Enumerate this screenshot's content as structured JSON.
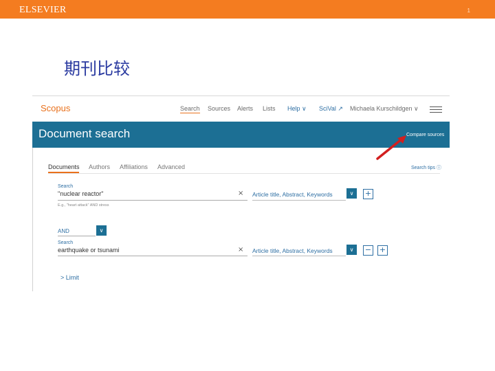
{
  "slide": {
    "logo": "ELSEVIER",
    "page_number": "1",
    "title": "期刊比较",
    "bar_color": "#f47c20",
    "title_color": "#2a3aa0"
  },
  "scopus": {
    "logo": "Scopus",
    "nav": {
      "search": "Search",
      "sources": "Sources",
      "alerts": "Alerts",
      "lists": "Lists",
      "help": "Help ∨",
      "scival": "SciVal ↗",
      "user": "Michaela Kurschildgen ∨"
    },
    "band": {
      "title": "Document search",
      "compare_link": "Compare sources",
      "color": "#1c6f94"
    },
    "tabs": [
      "Documents",
      "Authors",
      "Affiliations",
      "Advanced"
    ],
    "search_tips": "Search tips ⓘ",
    "row1": {
      "label": "Search",
      "value": "\"nuclear reactor\"",
      "clear": "×",
      "scope": "Article title, Abstract, Keywords",
      "hint": "E.g., \"heart attack\" AND stress"
    },
    "connector": "AND",
    "row2": {
      "label": "Search",
      "value": "earthquake or tsunami",
      "clear": "×",
      "scope": "Article title, Abstract, Keywords"
    },
    "limit": "> Limit",
    "icons": {
      "dropdown": "chevron-down-icon",
      "add": "plus-icon",
      "remove": "minus-icon",
      "menu": "hamburger-menu-icon",
      "annotation": "red-arrow-icon"
    },
    "accent_color": "#e9711c",
    "link_color": "#2d6ea3"
  }
}
